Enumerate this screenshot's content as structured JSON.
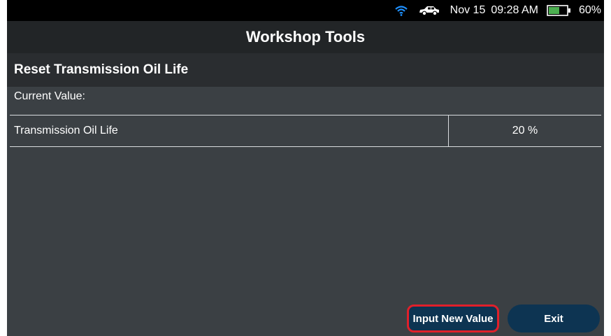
{
  "status_bar": {
    "date": "Nov 15",
    "time": "09:28 AM",
    "battery_percent": "60%",
    "battery_level": 0.6,
    "icons": [
      "wifi-icon",
      "car-icon",
      "battery-icon"
    ],
    "colors": {
      "wifi": "#1e90ff",
      "battery_fill": "#4caf50"
    }
  },
  "header": {
    "title": "Workshop Tools"
  },
  "section": {
    "title": "Reset Transmission Oil Life"
  },
  "current_value": {
    "label": "Current Value:",
    "rows": [
      {
        "name": "Transmission Oil Life",
        "value": "20 %"
      }
    ]
  },
  "buttons": {
    "input_new_value": "Input New Value",
    "exit": "Exit"
  },
  "colors": {
    "button_bg": "#0d3452",
    "highlight_border": "#e0202a",
    "background": "#3b4044"
  }
}
